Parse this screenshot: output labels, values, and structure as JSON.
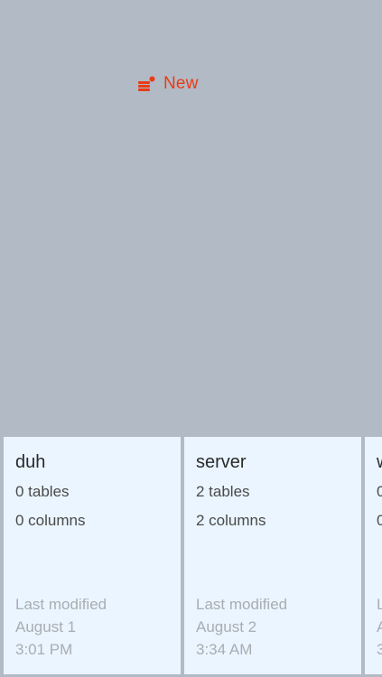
{
  "toolbar": {
    "new_label": "New",
    "new_icon": "database-add-icon",
    "accent_color": "#ea3b16"
  },
  "databases": [
    {
      "name": "duh",
      "tables": "0 tables",
      "columns": "0 columns",
      "modified_label": "Last modified",
      "modified_date": "August 1",
      "modified_time": "3:01 PM"
    },
    {
      "name": "server",
      "tables": "2 tables",
      "columns": "2 columns",
      "modified_label": "Last modified",
      "modified_date": "August 2",
      "modified_time": "3:34 AM"
    },
    {
      "name": "w",
      "tables": "0",
      "columns": "0",
      "modified_label": "L",
      "modified_date": "A",
      "modified_time": "3"
    }
  ],
  "colors": {
    "background": "#b1bac5",
    "card_background": "#eaf5ff"
  }
}
